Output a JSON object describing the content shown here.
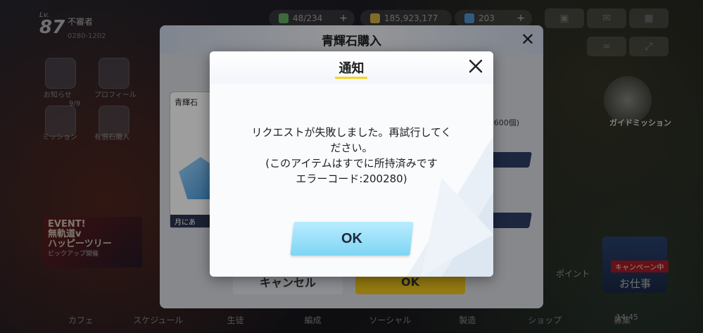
{
  "player": {
    "lv_label": "Lv.",
    "level": "87",
    "name": "不審者",
    "id": "0280-1202"
  },
  "resources": [
    {
      "name": "energy",
      "value": "48/234",
      "color": "#6fc26f"
    },
    {
      "name": "coins",
      "value": "185,923,177",
      "color": "#e9c54a"
    },
    {
      "name": "gems",
      "value": "203",
      "color": "#5aa7e6"
    }
  ],
  "side_menu": [
    {
      "label": "お知らせ"
    },
    {
      "label": "ミッション"
    },
    {
      "label": "プロフィール"
    },
    {
      "label": "有償石購入"
    }
  ],
  "mission_count": "9/9",
  "event_banner": {
    "line1": "EVENT!",
    "line2": "無軌道v",
    "line3": "ハッピーツリー",
    "line4": "ピックアップ開催"
  },
  "guide": {
    "label": "ガイドミッション"
  },
  "work": {
    "tag": "キャンペーン中",
    "label": "お仕事"
  },
  "side_right_mid": "ポイント",
  "bottom_nav": [
    "カフェ",
    "スケジュール",
    "生徒",
    "編成",
    "ソーシャル",
    "製造",
    "ショップ",
    "募集"
  ],
  "clock": "14:45",
  "purchase_dialog": {
    "title": "青輝石購入",
    "item_name": "青輝石",
    "item_footer": "月にあ",
    "qty_text": "600個)",
    "cancel_label": "キャンセル",
    "ok_label": "OK"
  },
  "notice": {
    "title": "通知",
    "message_lines": [
      "リクエストが失敗しました。再試行してく",
      "ださい。",
      "(このアイテムはすでに所持済みです",
      "エラーコード:200280)"
    ],
    "ok_label": "OK"
  },
  "colors": {
    "ok_button": "#8fdcf7",
    "title_underline": "#f4d61a",
    "purchase_ok": "#f1c51b"
  }
}
